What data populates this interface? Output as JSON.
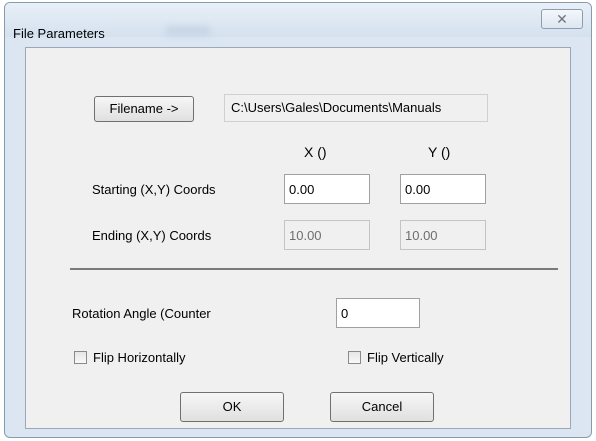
{
  "window": {
    "title": "File Parameters",
    "close_glyph": "✕"
  },
  "file": {
    "button_label": "Filename ->",
    "path": "C:\\Users\\Gales\\Documents\\Manuals"
  },
  "columns": {
    "x": "X ()",
    "y": "Y ()"
  },
  "starting": {
    "label": "Starting (X,Y) Coords",
    "x": "0.00",
    "y": "0.00"
  },
  "ending": {
    "label": "Ending (X,Y) Coords",
    "x": "10.00",
    "y": "10.00"
  },
  "rotation": {
    "label": "Rotation Angle (Counter",
    "value": "0"
  },
  "flip_horizontal": {
    "label": "Flip Horizontally",
    "checked": false
  },
  "flip_vertical": {
    "label": "Flip Vertically",
    "checked": false
  },
  "buttons": {
    "ok": "OK",
    "cancel": "Cancel"
  },
  "colors": {
    "title_bar": "#dbe6f2",
    "dialog_face": "#f0f0f0",
    "field_bg": "#ffffff",
    "disabled_text": "#6d6d6d"
  },
  "icons": {
    "close": "close-icon"
  }
}
